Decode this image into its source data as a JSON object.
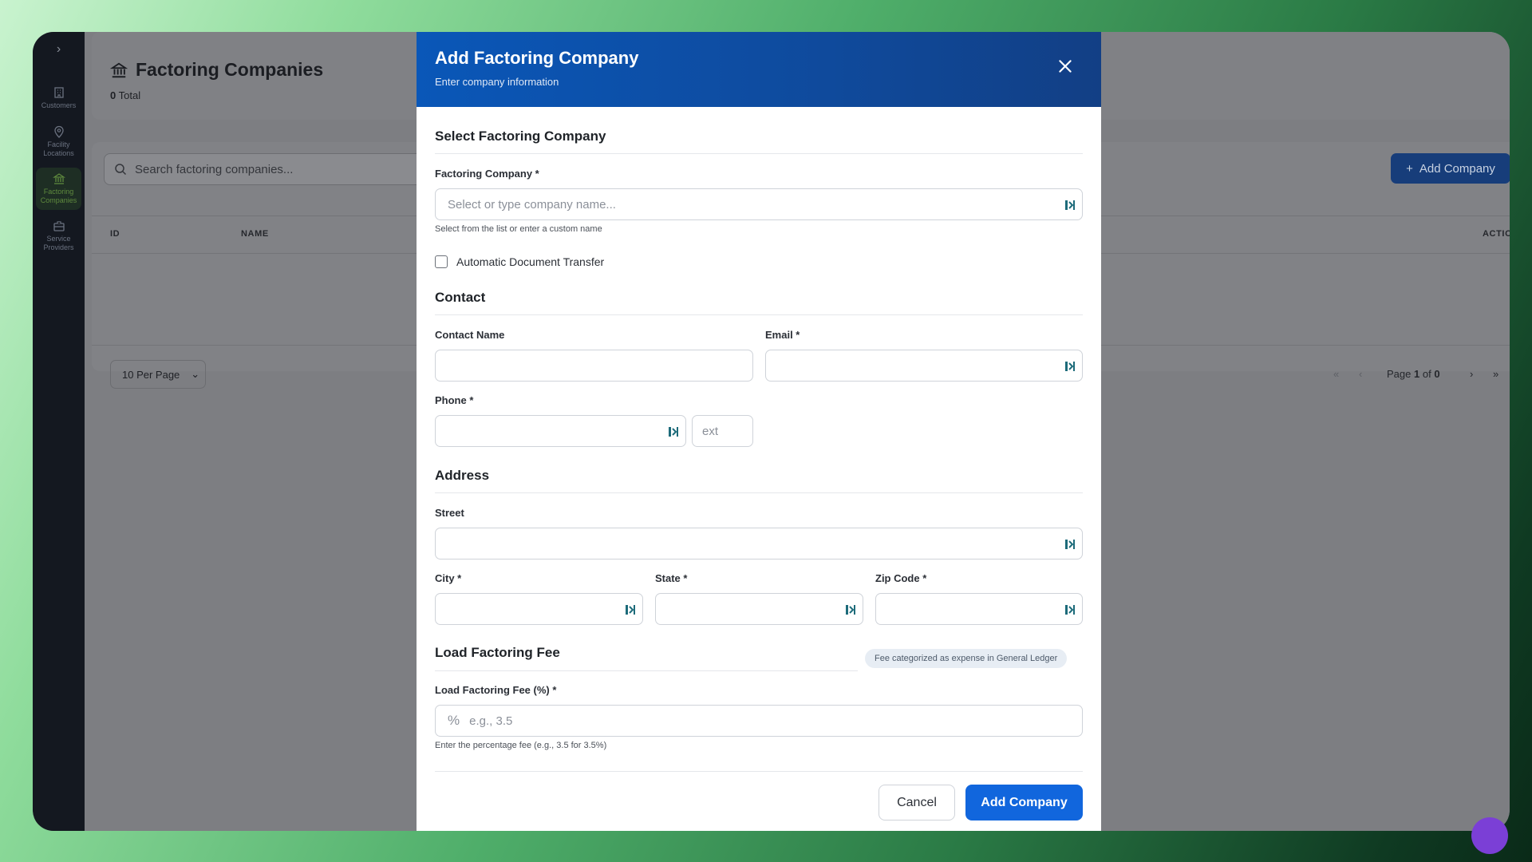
{
  "app": {
    "page_title": "Factoring Companies",
    "total_count": "0",
    "total_label": "Total",
    "add_button": "Add Company",
    "search_placeholder": "Search factoring companies...",
    "columns": [
      "ID",
      "NAME",
      "ACTIONS"
    ],
    "per_page": "10 Per Page",
    "page_prefix": "Page",
    "page_current": "1",
    "page_of": "of",
    "page_total": "0"
  },
  "sidebar": {
    "items": [
      {
        "label_1": "Customers",
        "label_2": "",
        "icon": "building-icon"
      },
      {
        "label_1": "Facility",
        "label_2": "Locations",
        "icon": "map-pin-icon"
      },
      {
        "label_1": "Factoring",
        "label_2": "Companies",
        "icon": "bank-icon",
        "active": true
      },
      {
        "label_1": "Service",
        "label_2": "Providers",
        "icon": "briefcase-icon"
      }
    ]
  },
  "modal": {
    "title": "Add Factoring Company",
    "subtitle": "Enter company information",
    "section_select": "Select Factoring Company",
    "factoring_company_label": "Factoring Company *",
    "factoring_company_placeholder": "Select or type company name...",
    "factoring_company_help": "Select from the list or enter a custom name",
    "auto_transfer_label": "Automatic Document Transfer",
    "section_contact": "Contact",
    "contact_name_label": "Contact Name",
    "email_label": "Email *",
    "phone_label": "Phone *",
    "ext_placeholder": "ext",
    "section_address": "Address",
    "street_label": "Street",
    "city_label": "City *",
    "state_label": "State *",
    "zip_label": "Zip Code *",
    "section_fee": "Load Factoring Fee",
    "fee_badge": "Fee categorized as expense in General Ledger",
    "fee_label": "Load Factoring Fee (%) *",
    "fee_placeholder": "e.g., 3.5",
    "fee_help": "Enter the percentage fee (e.g., 3.5 for 3.5%)",
    "cancel": "Cancel",
    "submit": "Add Company"
  },
  "colors": {
    "modal_header": "#0a57b8",
    "primary_button": "#1166dd",
    "sidebar_bg": "#141820"
  }
}
